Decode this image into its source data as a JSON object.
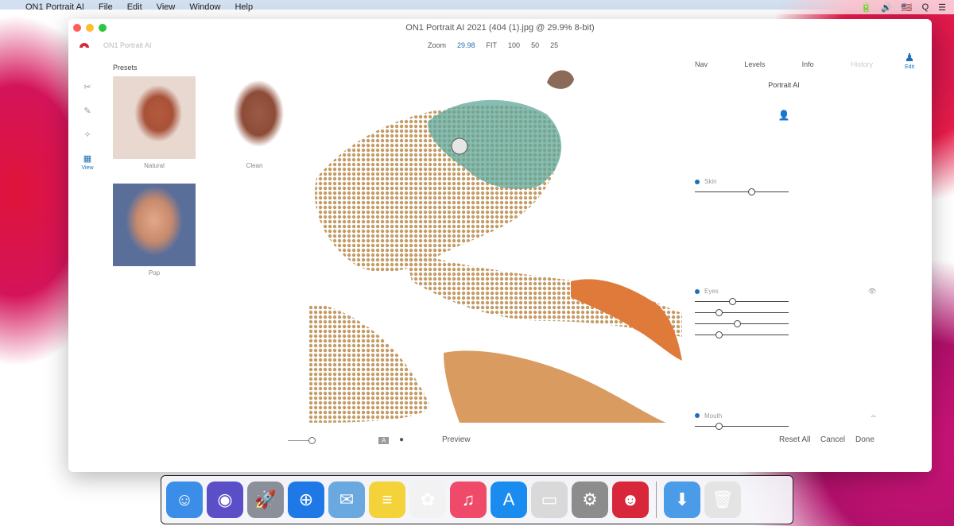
{
  "menubar": {
    "items": [
      "ON1 Portrait AI",
      "File",
      "Edit",
      "View",
      "Window",
      "Help"
    ],
    "status": [
      "🔋",
      "🔊",
      "🇺🇸",
      "Q",
      "☰"
    ]
  },
  "window": {
    "title": "ON1 Portrait AI 2021 (404 (1).jpg @ 29.9% 8-bit)",
    "app_name": "ON1 Portrait AI",
    "zoom": {
      "label": "Zoom",
      "value": "29.98",
      "fit": "FIT",
      "v100": "100",
      "v50": "50",
      "v25": "25"
    }
  },
  "tools": [
    {
      "name": "crop",
      "icon": "✂"
    },
    {
      "name": "brush",
      "icon": "✎"
    },
    {
      "name": "retouch",
      "icon": "✧"
    },
    {
      "name": "view",
      "icon": "▦",
      "label": "View",
      "active": true
    }
  ],
  "presets": {
    "title": "Presets",
    "items": [
      "Natural",
      "Clean",
      "Pop"
    ]
  },
  "panel": {
    "tabs": [
      "Nav",
      "Levels",
      "Info",
      "History"
    ],
    "title": "Portrait AI",
    "skin": {
      "label": "Skin",
      "value": 0.6
    },
    "eyes": {
      "label": "Eyes",
      "values": [
        0.4,
        0.25,
        0.45,
        0.25
      ]
    },
    "mouth": {
      "label": "Mouth",
      "value": 0.25
    }
  },
  "iconrail": {
    "edit_label": "Edit"
  },
  "bottombar": {
    "preview": "Preview",
    "reset_all": "Reset All",
    "cancel": "Cancel",
    "done": "Done",
    "a_badge": "A"
  },
  "dock": [
    {
      "name": "finder",
      "color": "#3b8ee8",
      "glyph": "☺"
    },
    {
      "name": "siri",
      "color": "#5a4fc7",
      "glyph": "◉"
    },
    {
      "name": "launchpad",
      "color": "#8a8f99",
      "glyph": "🚀"
    },
    {
      "name": "safari",
      "color": "#1e78e6",
      "glyph": "⊕"
    },
    {
      "name": "mail",
      "color": "#6aa8e0",
      "glyph": "✉"
    },
    {
      "name": "notes",
      "color": "#f4d23a",
      "glyph": "≡"
    },
    {
      "name": "photos",
      "color": "#f2f2f2",
      "glyph": "✿"
    },
    {
      "name": "music",
      "color": "#f04a6a",
      "glyph": "♫"
    },
    {
      "name": "app-store",
      "color": "#1a8cf0",
      "glyph": "A"
    },
    {
      "name": "preview",
      "color": "#d9d9d9",
      "glyph": "▭"
    },
    {
      "name": "system-preferences",
      "color": "#8c8c8c",
      "glyph": "⚙"
    },
    {
      "name": "on1-portrait",
      "color": "#d8263a",
      "glyph": "☻"
    },
    {
      "name": "downloads",
      "color": "#4a9be8",
      "glyph": "⬇"
    },
    {
      "name": "trash",
      "color": "#e4e4e4",
      "glyph": "🗑"
    }
  ]
}
